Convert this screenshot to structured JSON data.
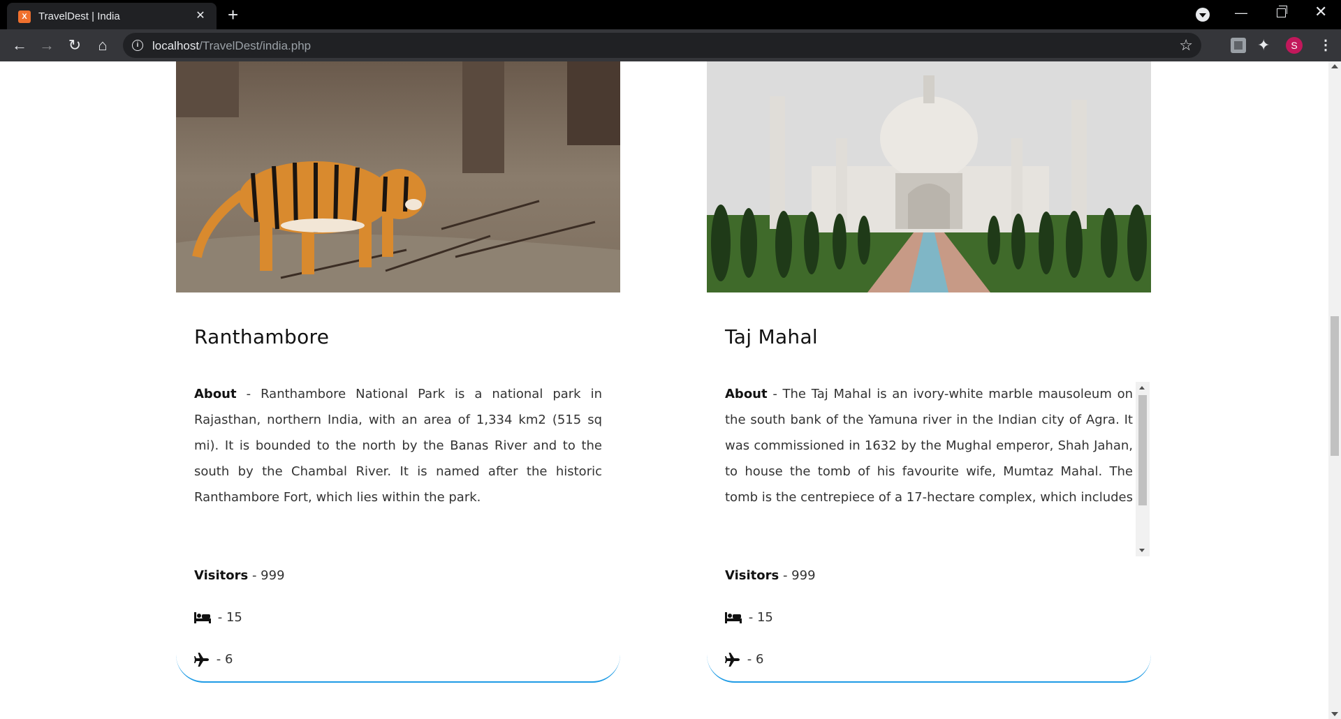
{
  "browser": {
    "tab_title": "TravelDest | India",
    "tab_favicon_text": "X",
    "new_tab_label": "+",
    "url_host": "localhost",
    "url_path": "/TravelDest/india.php",
    "profile_initial": "S"
  },
  "cards": [
    {
      "name": "Ranthambore",
      "about_label": "About",
      "about_text": " - Ranthambore National Park is a national park in Rajasthan, northern India, with an area of 1,334 km2 (515 sq mi). It is bounded to the north by the Banas River and to the south by the Chambal River. It is named after the historic Ranthambore Fort, which lies within the park.",
      "visitors_label": "Visitors",
      "visitors_value": " - 999",
      "hotels_value": " - 15",
      "flights_value": " - 6",
      "image": "tiger-photo"
    },
    {
      "name": "Taj Mahal",
      "about_label": "About",
      "about_text": " - The Taj Mahal is an ivory-white marble mausoleum on the south bank of the Yamuna river in the Indian city of Agra. It was commissioned in 1632 by the Mughal emperor, Shah Jahan, to house the tomb of his favourite wife, Mumtaz Mahal. The tomb is the centrepiece of a 17-hectare complex, which includes a mosque and a guest house, and",
      "visitors_label": "Visitors",
      "visitors_value": " - 999",
      "hotels_value": " - 15",
      "flights_value": " - 6",
      "image": "taj-mahal-photo"
    }
  ],
  "icons": {
    "hotel": "bed-icon",
    "flight": "plane-icon"
  },
  "colors": {
    "card_border": "#1e9be5",
    "favicon": "#f0702d",
    "avatar": "#c2185b"
  }
}
